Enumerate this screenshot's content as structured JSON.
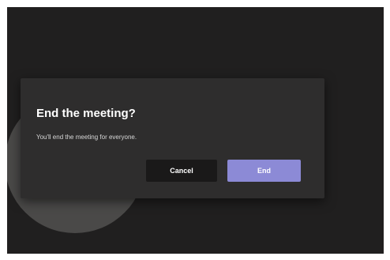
{
  "dialog": {
    "title": "End the meeting?",
    "message": "You'll end the meeting for everyone.",
    "cancel_label": "Cancel",
    "end_label": "End"
  },
  "colors": {
    "background": "#201f1f",
    "dialog": "#2e2d2d",
    "primary_button": "#8c8ad6",
    "secondary_button": "#1a1919"
  }
}
